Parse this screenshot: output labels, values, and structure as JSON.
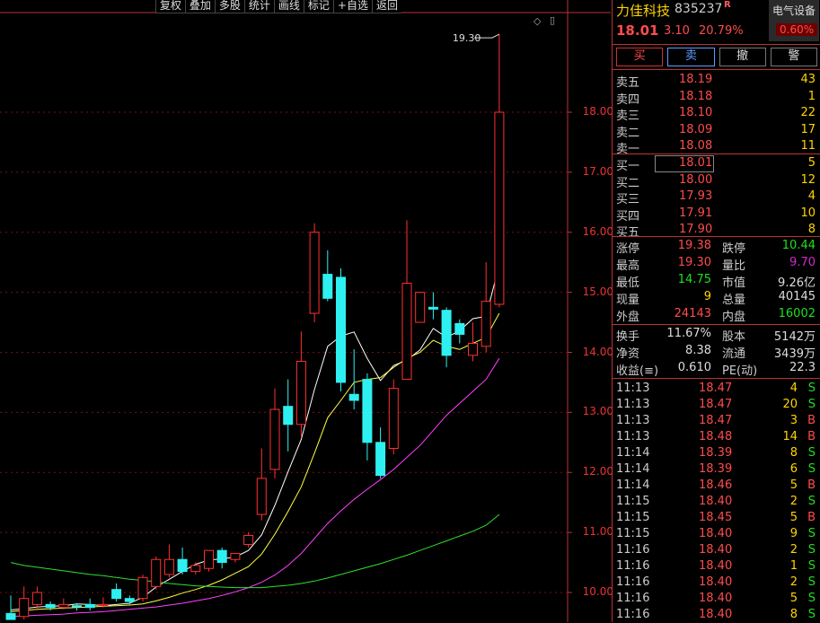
{
  "toolbar": {
    "items": [
      "复权",
      "叠加",
      "多股",
      "统计",
      "画线",
      "标记",
      "+自选",
      "返回"
    ]
  },
  "chart": {
    "controls": {
      "diamond": "◇",
      "square": "▯"
    },
    "high_marker": "19.30",
    "price_ticks": [
      "18.00",
      "17.00",
      "16.00",
      "15.00",
      "14.00",
      "13.00",
      "12.00",
      "11.00",
      "10.00"
    ],
    "colors": {
      "up": "#ff3030",
      "down": "#2ff0f0",
      "ma_white": "#ffffff",
      "ma_yellow": "#ffff40",
      "ma_magenta": "#ff40ff",
      "ma_green": "#30e030",
      "grid": "#7a1010"
    }
  },
  "chart_data": {
    "type": "candlestick",
    "ylim": [
      9.55,
      19.6
    ],
    "candles": [
      [
        9.65,
        9.55,
        9.95,
        9.55
      ],
      [
        9.6,
        9.9,
        10.1,
        9.55
      ],
      [
        9.8,
        10.0,
        10.1,
        9.7
      ],
      [
        9.8,
        9.75,
        9.85,
        9.7
      ],
      [
        9.75,
        9.8,
        9.9,
        9.72
      ],
      [
        9.78,
        9.76,
        9.82,
        9.7
      ],
      [
        9.8,
        9.75,
        9.9,
        9.7
      ],
      [
        9.78,
        9.8,
        9.92,
        9.75
      ],
      [
        10.05,
        9.9,
        10.15,
        9.85
      ],
      [
        9.9,
        9.85,
        9.95,
        9.8
      ],
      [
        9.9,
        10.25,
        10.3,
        9.85
      ],
      [
        10.1,
        10.55,
        10.6,
        10.05
      ],
      [
        10.3,
        10.55,
        10.8,
        10.25
      ],
      [
        10.55,
        10.35,
        10.75,
        10.3
      ],
      [
        10.35,
        10.45,
        10.5,
        10.3
      ],
      [
        10.4,
        10.7,
        10.7,
        10.35
      ],
      [
        10.7,
        10.5,
        10.75,
        10.4
      ],
      [
        10.55,
        10.65,
        10.65,
        10.5
      ],
      [
        10.8,
        10.95,
        11.0,
        10.75
      ],
      [
        11.3,
        11.9,
        12.4,
        11.2
      ],
      [
        12.05,
        13.05,
        13.4,
        11.9
      ],
      [
        13.1,
        12.8,
        13.55,
        12.35
      ],
      [
        12.8,
        13.85,
        14.35,
        12.6
      ],
      [
        14.65,
        16.0,
        16.15,
        14.5
      ],
      [
        15.3,
        14.9,
        15.7,
        14.85
      ],
      [
        15.25,
        13.5,
        15.4,
        13.35
      ],
      [
        13.3,
        13.2,
        14.05,
        13.05
      ],
      [
        13.55,
        12.5,
        13.65,
        12.2
      ],
      [
        12.5,
        11.95,
        12.75,
        11.9
      ],
      [
        12.4,
        13.4,
        13.55,
        12.3
      ],
      [
        13.55,
        15.15,
        16.2,
        13.55
      ],
      [
        14.5,
        15.0,
        15.0,
        14.5
      ],
      [
        14.75,
        14.72,
        15.0,
        14.55
      ],
      [
        14.7,
        13.95,
        14.75,
        13.75
      ],
      [
        14.48,
        14.3,
        14.55,
        14.15
      ],
      [
        13.95,
        14.15,
        14.5,
        13.85
      ],
      [
        14.1,
        14.85,
        15.5,
        14.0
      ],
      [
        14.8,
        18.0,
        19.3,
        14.75
      ]
    ],
    "ma_series": [
      {
        "color": "white",
        "values": [
          9.71,
          9.73,
          9.76,
          9.77,
          9.78,
          9.81,
          9.8,
          9.78,
          9.8,
          9.82,
          9.92,
          10.09,
          10.22,
          10.35,
          10.47,
          10.54,
          10.56,
          10.59,
          10.7,
          10.96,
          11.45,
          12.01,
          12.55,
          13.38,
          14.1,
          14.27,
          14.34,
          13.9,
          13.53,
          13.78,
          13.87,
          14.04,
          14.4,
          14.25,
          14.36,
          14.56,
          14.6,
          15.46
        ]
      },
      {
        "color": "yellow",
        "values": [
          9.68,
          9.7,
          9.72,
          9.73,
          9.74,
          9.75,
          9.76,
          9.77,
          9.78,
          9.79,
          9.81,
          9.86,
          9.92,
          9.99,
          10.05,
          10.12,
          10.21,
          10.32,
          10.43,
          10.64,
          10.97,
          11.35,
          11.76,
          12.32,
          12.91,
          13.2,
          13.5,
          13.55,
          13.58,
          13.75,
          13.9,
          14.0,
          14.2,
          14.1,
          14.05,
          14.15,
          14.25,
          14.65
        ]
      },
      {
        "color": "magenta",
        "values": [
          9.6,
          9.61,
          9.62,
          9.63,
          9.64,
          9.66,
          9.67,
          9.68,
          9.7,
          9.72,
          9.74,
          9.76,
          9.79,
          9.82,
          9.86,
          9.9,
          9.95,
          10.01,
          10.08,
          10.17,
          10.29,
          10.45,
          10.65,
          10.9,
          11.15,
          11.36,
          11.55,
          11.72,
          11.88,
          12.05,
          12.25,
          12.45,
          12.7,
          12.95,
          13.15,
          13.35,
          13.55,
          13.9
        ]
      },
      {
        "color": "green",
        "values": [
          10.5,
          10.45,
          10.42,
          10.39,
          10.36,
          10.33,
          10.3,
          10.28,
          10.25,
          10.22,
          10.2,
          10.18,
          10.15,
          10.13,
          10.11,
          10.1,
          10.09,
          10.08,
          10.08,
          10.08,
          10.1,
          10.12,
          10.15,
          10.19,
          10.24,
          10.3,
          10.36,
          10.42,
          10.48,
          10.55,
          10.62,
          10.7,
          10.78,
          10.86,
          10.94,
          11.02,
          11.12,
          11.3
        ]
      }
    ]
  },
  "stock": {
    "name": "力佳科技",
    "code": "835237",
    "flag": "R",
    "sector": "电气设备",
    "sector_pct": "0.60%",
    "last": "18.01",
    "change": "3.10",
    "change_pct": "20.79%"
  },
  "trade_buttons": {
    "buy": "买",
    "sell": "卖",
    "cancel": "撤",
    "alert": "警"
  },
  "orderbook": {
    "asks": [
      {
        "label": "卖五",
        "price": "18.19",
        "vol": "43"
      },
      {
        "label": "卖四",
        "price": "18.18",
        "vol": "1"
      },
      {
        "label": "卖三",
        "price": "18.10",
        "vol": "22"
      },
      {
        "label": "卖二",
        "price": "18.09",
        "vol": "17"
      },
      {
        "label": "卖一",
        "price": "18.08",
        "vol": "11"
      }
    ],
    "bids": [
      {
        "label": "买一",
        "price": "18.01",
        "vol": "5"
      },
      {
        "label": "买二",
        "price": "18.00",
        "vol": "12"
      },
      {
        "label": "买三",
        "price": "17.93",
        "vol": "4"
      },
      {
        "label": "买四",
        "price": "17.91",
        "vol": "10"
      },
      {
        "label": "买五",
        "price": "17.90",
        "vol": "8"
      }
    ]
  },
  "stats": {
    "rows": [
      {
        "l1": "涨停",
        "v1": "19.38",
        "c1": "red",
        "l2": "跌停",
        "v2": "10.44",
        "c2": "green"
      },
      {
        "l1": "最高",
        "v1": "19.30",
        "c1": "red",
        "l2": "量比",
        "v2": "9.70",
        "c2": "purple"
      },
      {
        "l1": "最低",
        "v1": "14.75",
        "c1": "green",
        "l2": "市值",
        "v2": "9.26亿",
        "c2": "white"
      },
      {
        "l1": "现量",
        "v1": "9",
        "c1": "yellow",
        "l2": "总量",
        "v2": "40145",
        "c2": "white"
      },
      {
        "l1": "外盘",
        "v1": "24143",
        "c1": "red",
        "l2": "内盘",
        "v2": "16002",
        "c2": "green"
      }
    ],
    "rows2": [
      {
        "l1": "换手",
        "v1": "11.67%",
        "c1": "white",
        "l2": "股本",
        "v2": "5142万",
        "c2": "white"
      },
      {
        "l1": "净资",
        "v1": "8.38",
        "c1": "white",
        "l2": "流通",
        "v2": "3439万",
        "c2": "white"
      },
      {
        "l1": "收益(≡)",
        "v1": "0.610",
        "c1": "white",
        "l2": "PE(动)",
        "v2": "22.3",
        "c2": "white"
      }
    ]
  },
  "ticks": [
    {
      "time": "11:13",
      "price": "18.47",
      "vol": "4",
      "side": "S"
    },
    {
      "time": "11:13",
      "price": "18.47",
      "vol": "20",
      "side": "S"
    },
    {
      "time": "11:13",
      "price": "18.47",
      "vol": "3",
      "side": "B"
    },
    {
      "time": "11:13",
      "price": "18.48",
      "vol": "14",
      "side": "B"
    },
    {
      "time": "11:14",
      "price": "18.39",
      "vol": "8",
      "side": "S"
    },
    {
      "time": "11:14",
      "price": "18.39",
      "vol": "6",
      "side": "S"
    },
    {
      "time": "11:14",
      "price": "18.46",
      "vol": "5",
      "side": "B"
    },
    {
      "time": "11:15",
      "price": "18.40",
      "vol": "2",
      "side": "S"
    },
    {
      "time": "11:15",
      "price": "18.45",
      "vol": "5",
      "side": "B"
    },
    {
      "time": "11:15",
      "price": "18.40",
      "vol": "9",
      "side": "S"
    },
    {
      "time": "11:16",
      "price": "18.40",
      "vol": "2",
      "side": "S"
    },
    {
      "time": "11:16",
      "price": "18.40",
      "vol": "1",
      "side": "S"
    },
    {
      "time": "11:16",
      "price": "18.40",
      "vol": "2",
      "side": "S"
    },
    {
      "time": "11:16",
      "price": "18.40",
      "vol": "5",
      "side": "S"
    },
    {
      "time": "11:16",
      "price": "18.40",
      "vol": "8",
      "side": "S"
    }
  ]
}
